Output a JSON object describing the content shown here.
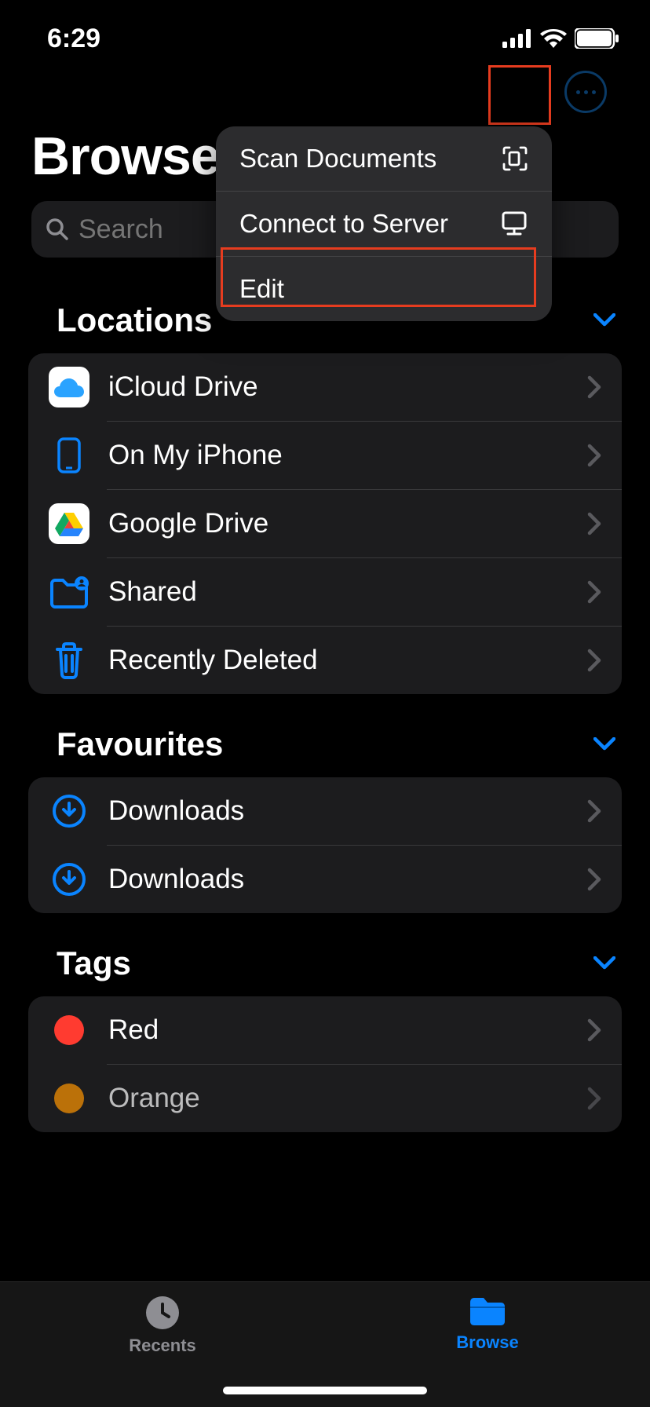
{
  "status": {
    "time": "6:29"
  },
  "header": {
    "title": "Browse",
    "search_placeholder": "Search"
  },
  "menu": {
    "scan": "Scan Documents",
    "connect": "Connect to Server",
    "edit": "Edit"
  },
  "sections": {
    "locations": {
      "title": "Locations",
      "items": [
        {
          "label": "iCloud Drive",
          "icon": "icloud"
        },
        {
          "label": "On My iPhone",
          "icon": "iphone"
        },
        {
          "label": "Google Drive",
          "icon": "gdrive"
        },
        {
          "label": "Shared",
          "icon": "shared"
        },
        {
          "label": "Recently Deleted",
          "icon": "trash"
        }
      ]
    },
    "favourites": {
      "title": "Favourites",
      "items": [
        {
          "label": "Downloads",
          "icon": "download"
        },
        {
          "label": "Downloads",
          "icon": "download"
        }
      ]
    },
    "tags": {
      "title": "Tags",
      "items": [
        {
          "label": "Red",
          "color": "#ff3b30"
        },
        {
          "label": "Orange",
          "color": "#ff9500"
        }
      ]
    }
  },
  "tabs": {
    "recents": "Recents",
    "browse": "Browse"
  }
}
